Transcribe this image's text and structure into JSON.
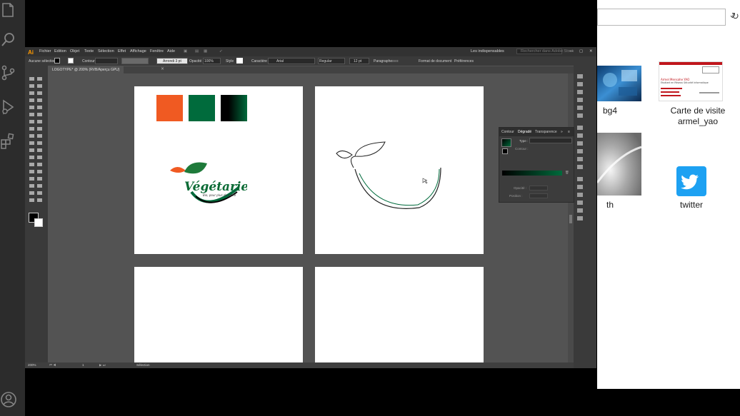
{
  "vscode": {
    "icons": [
      "files-icon",
      "search-icon",
      "source-control-icon",
      "run-debug-icon",
      "extensions-icon",
      "account-icon"
    ]
  },
  "explorer": {
    "files": [
      {
        "name": "bg4"
      },
      {
        "name": "Carte de visite armel_yao",
        "card_name": "Armel Mensahe YAO",
        "card_title": "Etudiant en Réseau Sécurité Informatique"
      },
      {
        "name": "th"
      },
      {
        "name": "twitter"
      }
    ]
  },
  "illustrator": {
    "logo": "Ai",
    "menu": [
      "Fichier",
      "Edition",
      "Objet",
      "Texte",
      "Sélection",
      "Effet",
      "Affichage",
      "Fenêtre",
      "Aide"
    ],
    "workspace": "Les indispensables",
    "search_placeholder": "Rechercher dans Adobe Stock",
    "control": {
      "selection": "Aucune sélection",
      "stroke_label": "Contour",
      "brush": "Arrondi 3 pt",
      "opacity_label": "Opacité",
      "opacity": "100%",
      "style_label": "Style",
      "char_label": "Caractère",
      "font": "Arial",
      "font_style": "Regular",
      "font_size": "12 pt",
      "para_label": "Paragraphe",
      "doc_format": "Format de document",
      "prefs": "Préférences"
    },
    "doc_tab": "LOGOTYPE* @ 200% (RVB/Aperçu GPU)",
    "status": {
      "zoom": "200%",
      "artboard": "1",
      "mode": "Sélection"
    },
    "swatches": [
      "#f05a22",
      "#006b3c",
      "#000000"
    ],
    "logo_art": {
      "wordmark": "Végétarien",
      "tagline": "Bio, pour plus de santé"
    },
    "gradient_panel": {
      "tabs": [
        "Contour",
        "Dégradé",
        "Transparence"
      ],
      "type_label": "Type :",
      "contour_label": "Contour :",
      "opacity_label": "Opacité :",
      "position_label": "Position :"
    }
  }
}
